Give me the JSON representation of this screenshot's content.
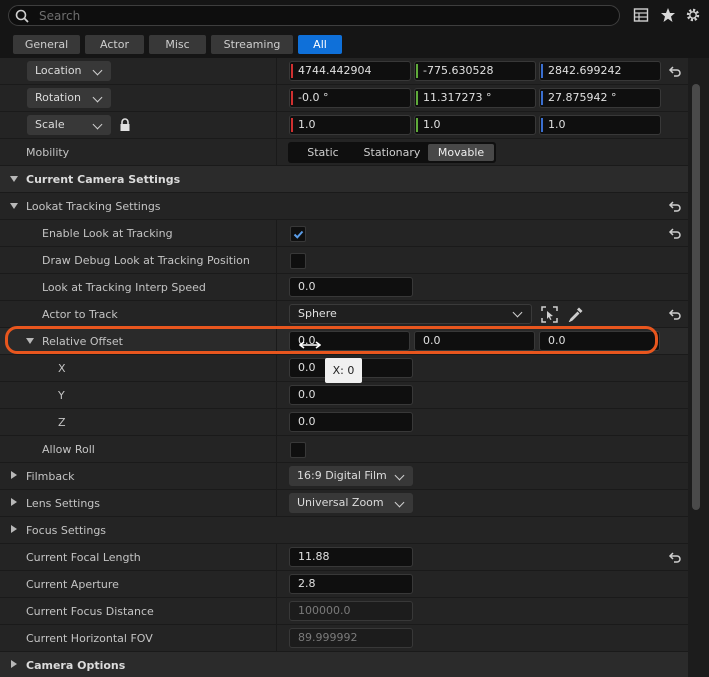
{
  "search": {
    "placeholder": "Search"
  },
  "toolbar_icons": [
    "table-view-icon",
    "star-icon",
    "gear-icon"
  ],
  "filters": [
    "General",
    "Actor",
    "Misc",
    "Streaming",
    "All"
  ],
  "active_filter": "All",
  "transform": {
    "location": {
      "label": "Location",
      "x": "4744.442904",
      "y": "-775.630528",
      "z": "2842.699242"
    },
    "rotation": {
      "label": "Rotation",
      "x": "-0.0 °",
      "y": "11.317273 °",
      "z": "27.875942 °"
    },
    "scale": {
      "label": "Scale",
      "x": "1.0",
      "y": "1.0",
      "z": "1.0"
    }
  },
  "mobility": {
    "label": "Mobility",
    "options": [
      "Static",
      "Stationary",
      "Movable"
    ],
    "selected": "Movable"
  },
  "camera_settings": {
    "label": "Current Camera Settings"
  },
  "lookat": {
    "label": "Lookat Tracking Settings",
    "enable": {
      "label": "Enable Look at Tracking",
      "checked": true
    },
    "draw_debug": {
      "label": "Draw Debug Look at Tracking Position",
      "checked": false
    },
    "interp_speed": {
      "label": "Look at Tracking Interp Speed",
      "value": "0.0"
    },
    "actor_to_track": {
      "label": "Actor to Track",
      "value": "Sphere"
    },
    "relative_offset": {
      "label": "Relative Offset",
      "x": "0.0",
      "y": "0.0",
      "z": "0.0"
    },
    "x": {
      "label": "X",
      "value": "0.0"
    },
    "y": {
      "label": "Y",
      "value": "0.0"
    },
    "z": {
      "label": "Z",
      "value": "0.0"
    },
    "allow_roll": {
      "label": "Allow Roll",
      "checked": false
    }
  },
  "tooltip": "X: 0",
  "filmback": {
    "label": "Filmback",
    "value": "16:9 Digital Film"
  },
  "lens": {
    "label": "Lens Settings",
    "value": "Universal Zoom"
  },
  "focus": {
    "label": "Focus Settings"
  },
  "focal_length": {
    "label": "Current Focal Length",
    "value": "11.88"
  },
  "aperture": {
    "label": "Current Aperture",
    "value": "2.8"
  },
  "focus_distance": {
    "label": "Current Focus Distance",
    "value": "100000.0"
  },
  "hfov": {
    "label": "Current Horizontal FOV",
    "value": "89.999992"
  },
  "camera_options": {
    "label": "Camera Options"
  },
  "colors": {
    "x_axis": "#d03030",
    "y_axis": "#5faa3a",
    "z_axis": "#3a6fd0",
    "highlight": "#e8561e",
    "active_tab": "#0f70d9"
  }
}
